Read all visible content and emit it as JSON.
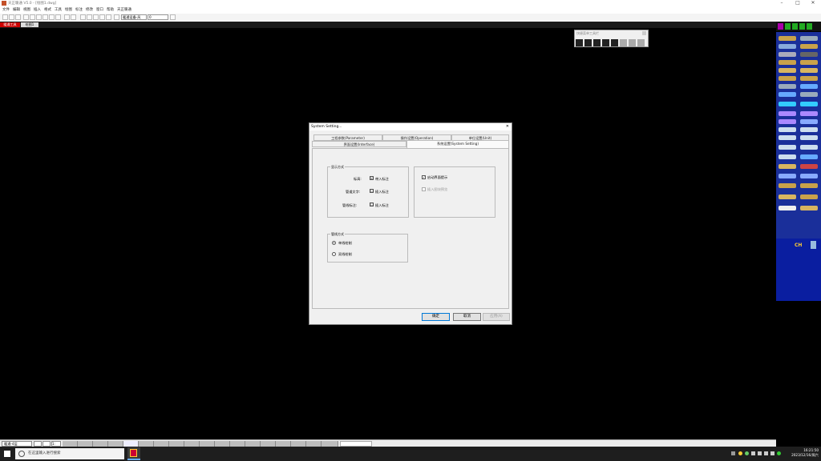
{
  "window": {
    "title": "天正暖通 V5.0 - [绘图1.dwg]",
    "minimize": "–",
    "maximize": "□",
    "close": "✕"
  },
  "menu": [
    "文件",
    "编辑",
    "视图",
    "插入",
    "格式",
    "工具",
    "绘图",
    "标注",
    "修改",
    "窗口",
    "帮助",
    "天正暖通"
  ],
  "toolbar": {
    "layer_combo": "暖通设备-风",
    "color_combo": "0"
  },
  "doc_tabs": [
    "暖通工具",
    "绘图1"
  ],
  "float_palette": {
    "title": "快捷菜单工具栏"
  },
  "dialog": {
    "title": "System Setting...",
    "close": "✕",
    "tabs": [
      "工程参数(Parameter)",
      "操作设置(Operation)",
      "单位设置(Unit)",
      "界面设置(Interface)",
      "系统设置(System Setting)"
    ],
    "group_display": {
      "label": "显示方式",
      "rows": [
        {
          "label": "标高:",
          "checkbox": "☑",
          "option": "带入标注",
          "checked": true
        },
        {
          "label": "管道文字:",
          "checkbox": "☐",
          "option": "插入标注",
          "checked": false
        },
        {
          "label": "管线标注:",
          "checkbox": "☐",
          "option": "插入标注",
          "checked": false
        }
      ]
    },
    "group_right": {
      "items": [
        {
          "label": "启动界面提示",
          "checked": true
        },
        {
          "label": "插入图块预览",
          "checked": false
        }
      ]
    },
    "group_line": {
      "label": "管线方式",
      "options": [
        {
          "label": "单线绘制",
          "selected": true
        },
        {
          "label": "双线绘制",
          "selected": false
        }
      ]
    },
    "buttons": {
      "ok": "确定",
      "cancel": "取消",
      "apply": "应用(A)"
    }
  },
  "right_panel": {
    "logo": "CH"
  },
  "statusbar": {
    "coord": "暖通-4层",
    "zoom": "1:"
  },
  "taskbar": {
    "search_placeholder": "在这里输入进行搜索",
    "time": "16:21:50",
    "date": "2023/12/16/周六"
  },
  "colors": {
    "panel_blue": "#1a2f9a",
    "dialog_bg": "#f0f0f0",
    "canvas": "#000000",
    "tab_active": "#c00000"
  }
}
